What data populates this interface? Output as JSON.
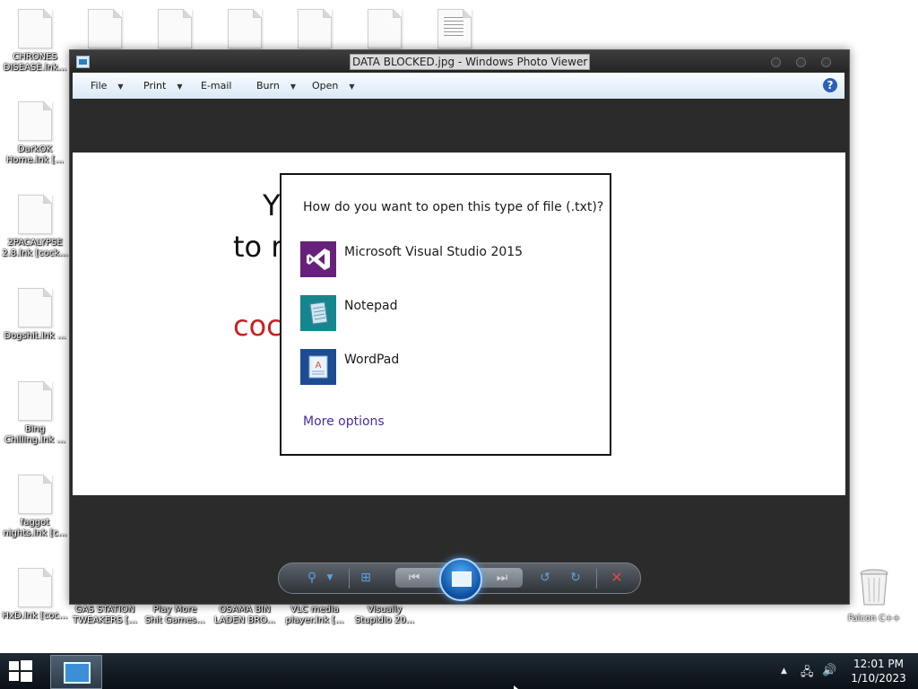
{
  "desktop": {
    "icons_left": [
      {
        "label": "CHRONES\nDISEASE.lnk..."
      },
      {
        "label": "DarkOK\nHome.lnk [..."
      },
      {
        "label": "2PACALYPSE\n2.8.lnk [cock..."
      },
      {
        "label": "Dogshit.lnk ..."
      },
      {
        "label": "Bing\nChilling.lnk ..."
      },
      {
        "label": "faggot\nnights.lnk [c..."
      },
      {
        "label": "HxD.lnk [coc..."
      }
    ],
    "icons_bottom": [
      {
        "label": "GAS STATION\nTWEAKERS [..."
      },
      {
        "label": "Play More\nShit Games..."
      },
      {
        "label": "OSAMA BIN\nLADEN BRO..."
      },
      {
        "label": "VLC media\nplayer.lnk [..."
      },
      {
        "label": "Visually\nStupidio 20..."
      }
    ],
    "recycle_label": "Falcon C++"
  },
  "viewer": {
    "title": "DATA BLOCKED.jpg - Windows Photo Viewer",
    "menu": [
      "File",
      "Print",
      "E-mail",
      "Burn",
      "Open"
    ],
    "help": "?",
    "photo_text": {
      "line1": "Y",
      "line2": "to r",
      "line3": "coc"
    }
  },
  "dialog": {
    "question": "How do you want to open this type of file (.txt)?",
    "options": [
      {
        "name": "Microsoft Visual Studio 2015",
        "icon": "visual-studio-icon"
      },
      {
        "name": "Notepad",
        "icon": "notepad-icon"
      },
      {
        "name": "WordPad",
        "icon": "wordpad-icon"
      }
    ],
    "more_options": "More options"
  },
  "controls": {
    "buttons": [
      "zoom",
      "actual-size",
      "previous",
      "slideshow",
      "next",
      "rotate-ccw",
      "rotate-cw",
      "delete"
    ]
  },
  "taskbar": {
    "time": "12:01 PM",
    "date": "1/10/2023"
  }
}
